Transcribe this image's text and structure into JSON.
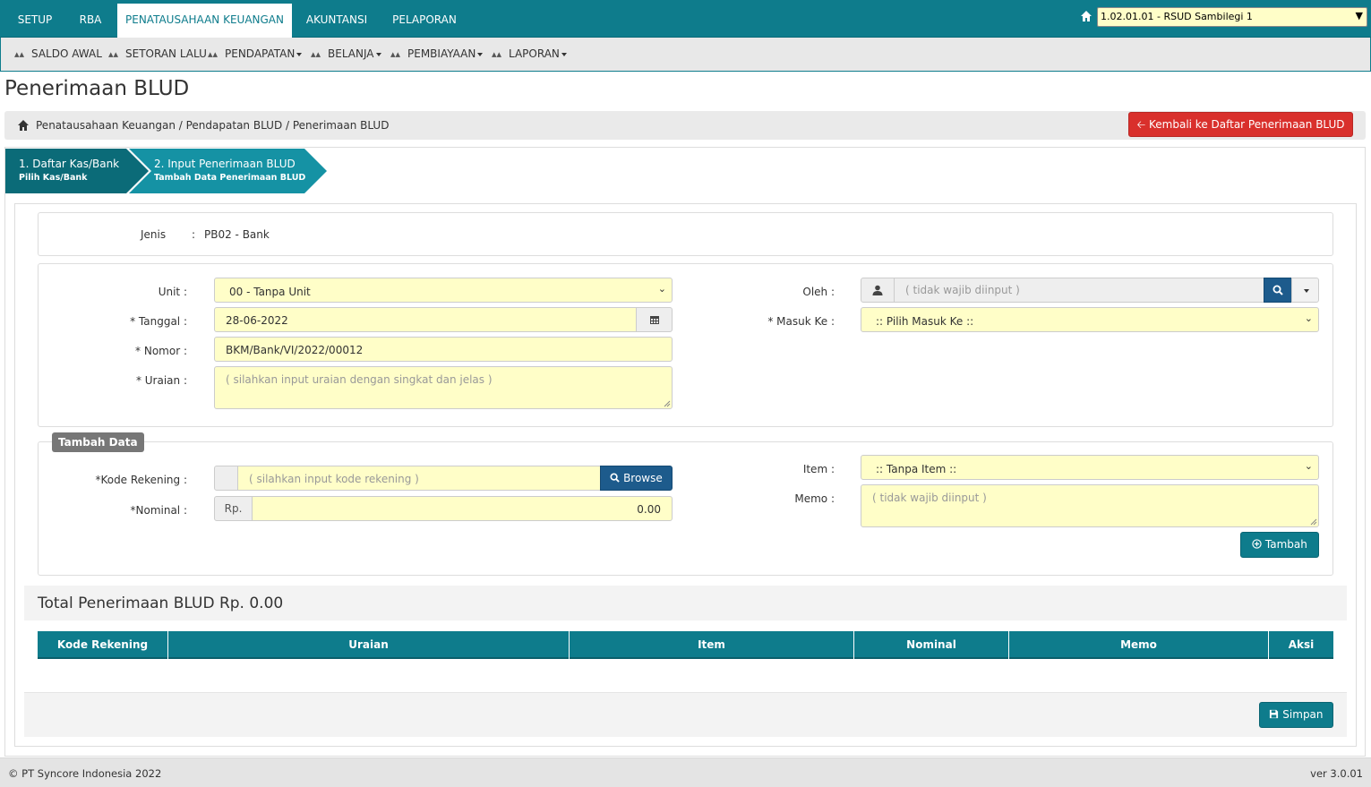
{
  "topnav": {
    "tabs": [
      "SETUP",
      "RBA",
      "PENATAUSAHAAN KEUANGAN",
      "AKUNTANSI",
      "PELAPORAN"
    ],
    "active_tab": "PENATAUSAHAAN KEUANGAN",
    "unit_select": "1.02.01.01 - RSUD Sambilegi 1"
  },
  "subnav": {
    "items": [
      "SALDO AWAL",
      "SETORAN LALU",
      "PENDAPATAN",
      "BELANJA",
      "PEMBIAYAAN",
      "LAPORAN"
    ]
  },
  "page": {
    "title": "Penerimaan BLUD",
    "breadcrumb": "Penatausahaan Keuangan / Pendapatan BLUD / Penerimaan BLUD",
    "back_button": "Kembali ke Daftar Penerimaan BLUD"
  },
  "steps": [
    {
      "title": "1. Daftar Kas/Bank",
      "subtitle": "Pilih Kas/Bank"
    },
    {
      "title": "2. Input Penerimaan BLUD",
      "subtitle": "Tambah Data Penerimaan BLUD"
    }
  ],
  "jenis": {
    "label": "Jenis",
    "value": "PB02 - Bank"
  },
  "form": {
    "unit_label": "Unit :",
    "unit_value": "00 - Tanpa Unit",
    "tanggal_label": "* Tanggal :",
    "tanggal_value": "28-06-2022",
    "nomor_label": "* Nomor :",
    "nomor_value": "BKM/Bank/VI/2022/00012",
    "uraian_label": "* Uraian :",
    "uraian_placeholder": "( silahkan input uraian dengan singkat dan jelas )",
    "oleh_label": "Oleh :",
    "oleh_placeholder": "( tidak wajib diinput )",
    "masuk_label": "* Masuk Ke :",
    "masuk_value": ":: Pilih Masuk Ke ::"
  },
  "tambah_data": {
    "legend": "Tambah Data",
    "kode_label": "*Kode Rekening :",
    "kode_placeholder": "( silahkan input kode rekening )",
    "browse_label": "Browse",
    "nominal_label": "*Nominal :",
    "nominal_prefix": "Rp.",
    "nominal_value": "0.00",
    "item_label": "Item :",
    "item_value": ":: Tanpa Item ::",
    "memo_label": "Memo :",
    "memo_placeholder": "( tidak wajib diinput )",
    "tambah_button": "Tambah"
  },
  "total": {
    "text": "Total Penerimaan BLUD Rp. 0.00"
  },
  "table": {
    "headers": [
      "Kode Rekening",
      "Uraian",
      "Item",
      "Nominal",
      "Memo",
      "Aksi"
    ],
    "rows": []
  },
  "save_button": "Simpan",
  "footer": {
    "copyright": "© PT Syncore Indonesia 2022",
    "version": "ver 3.0.01"
  },
  "colors": {
    "primary": "#0e7c8c",
    "danger": "#d9302c",
    "input_bg": "#fffec8",
    "browse": "#1d5b8c"
  }
}
